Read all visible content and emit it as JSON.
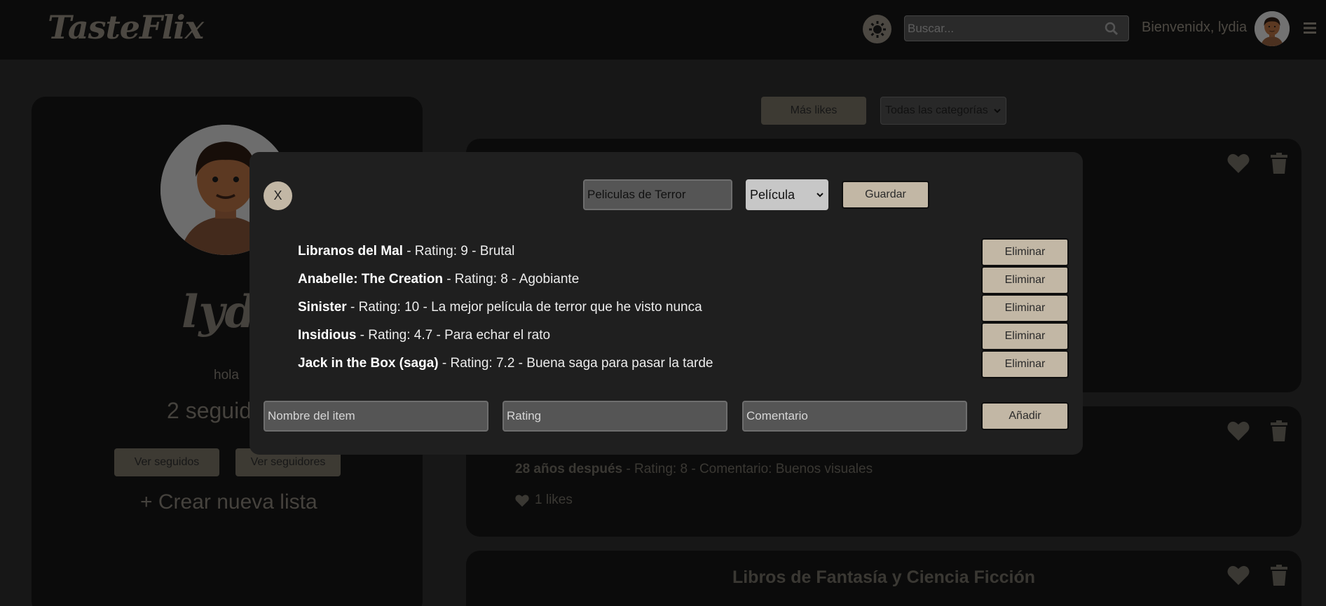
{
  "header": {
    "logo": "TasteFlix",
    "search_placeholder": "Buscar...",
    "welcome": "Bienvenidx, lydia"
  },
  "profile": {
    "username": "lydia",
    "bio": "hola",
    "followers": "2 seguidores",
    "btn_following": "Ver seguidos",
    "btn_followers": "Ver seguidores",
    "new_list": "+ Crear nueva lista"
  },
  "filters": {
    "sort_label": "Más likes",
    "category_selected": "Todas las categorías"
  },
  "cards": [
    {
      "item_name": "28 años después",
      "item_rest": " - Rating: 8 - Comentario: Buenos visuales",
      "likes": "1 likes"
    },
    {
      "title": "Libros de Fantasía y Ciencia Ficción"
    }
  ],
  "modal": {
    "close_label": "X",
    "list_name": "Peliculas de Terror",
    "type_selected": "Película",
    "save_label": "Guardar",
    "delete_label": "Eliminar",
    "items": [
      {
        "name": "Libranos del Mal",
        "rest": " - Rating: 9 - Brutal"
      },
      {
        "name": "Anabelle: The Creation",
        "rest": " - Rating: 8 - Agobiante"
      },
      {
        "name": "Sinister",
        "rest": " - Rating: 10 - La mejor película de terror que he visto nunca"
      },
      {
        "name": "Insidious",
        "rest": " - Rating: 4.7 - Para echar el rato"
      },
      {
        "name": "Jack in the Box (saga)",
        "rest": " - Rating: 7.2 - Buena saga para pasar la tarde"
      }
    ],
    "new_item": {
      "name_placeholder": "Nombre del item",
      "rating_placeholder": "Rating",
      "comment_placeholder": "Comentario",
      "add_label": "Añadir"
    }
  },
  "colors": {
    "accent": "#c2b7a5",
    "background": "#2b2b2b",
    "panel": "#141414"
  }
}
